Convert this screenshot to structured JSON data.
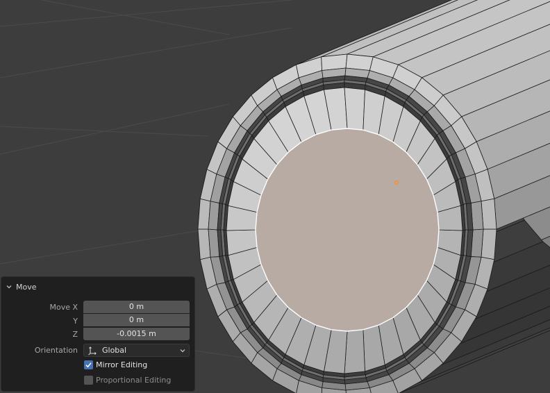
{
  "colors": {
    "viewport_bg": "#3d3d3d",
    "grid_line": "#4a4a4a",
    "mesh_face": "#a6a6a6",
    "mesh_edge": "#1a1a1a",
    "selected_face": "#b8aba3",
    "selected_edge": "#ffffff",
    "origin_dot": "#ff8c1a",
    "panel_bg": "#1f1f1f",
    "field_bg": "#545454",
    "checkbox_on": "#4772b3"
  },
  "panel": {
    "title": "Move",
    "move_x_label": "Move X",
    "move_x_value": "0 m",
    "y_label": "Y",
    "y_value": "0 m",
    "z_label": "Z",
    "z_value": "-0.0015 m",
    "orientation_label": "Orientation",
    "orientation_value": "Global",
    "mirror_label": "Mirror Editing",
    "mirror_checked": true,
    "proportional_label": "Proportional Editing",
    "proportional_checked": false
  }
}
